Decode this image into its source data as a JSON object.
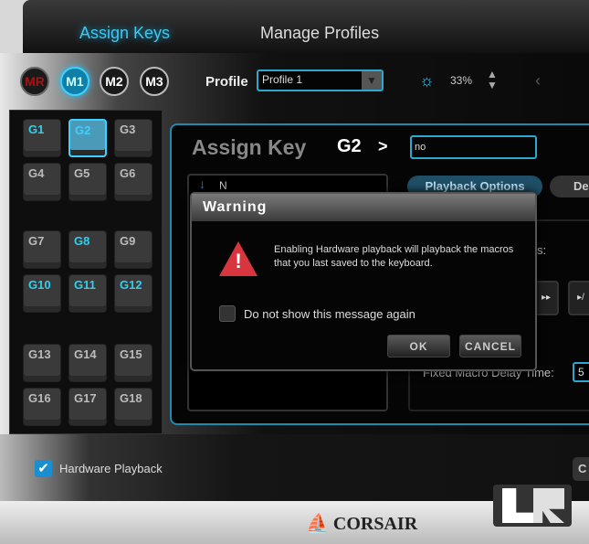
{
  "tabs": {
    "assign_keys": "Assign Keys",
    "manage_profiles": "Manage Profiles"
  },
  "modes": [
    "MR",
    "M1",
    "M2",
    "M3"
  ],
  "profile": {
    "label": "Profile",
    "value": "Profile 1"
  },
  "brightness": "33%",
  "gkeys": [
    "G1",
    "G2",
    "G3",
    "G4",
    "G5",
    "G6",
    "G7",
    "G8",
    "G9",
    "G10",
    "G11",
    "G12",
    "G13",
    "G14",
    "G15",
    "G16",
    "G17",
    "G18"
  ],
  "assign": {
    "title": "Assign Key",
    "key": "G2",
    "chevron": ">",
    "name_value": "no"
  },
  "macro": {
    "entry": "N"
  },
  "buttons": {
    "playback_options": "Playback Options",
    "de": "De",
    "c": "C"
  },
  "settings": {
    "colon": "s:",
    "delay_label": "Fixed Macro Delay Time:",
    "delay_value": "5"
  },
  "hardware_playback": {
    "label": "Hardware Playback",
    "checked": true
  },
  "dialog": {
    "title": "Warning",
    "message": "Enabling Hardware playback will playback the macros that you last saved to the keyboard.",
    "checkbox_label": "Do not show this message again",
    "ok": "OK",
    "cancel": "CANCEL"
  },
  "footer": {
    "brand": "CORSAIR",
    "watermark": "LR"
  },
  "colors": {
    "accent": "#3ec8f0",
    "warning": "#d8363e"
  }
}
